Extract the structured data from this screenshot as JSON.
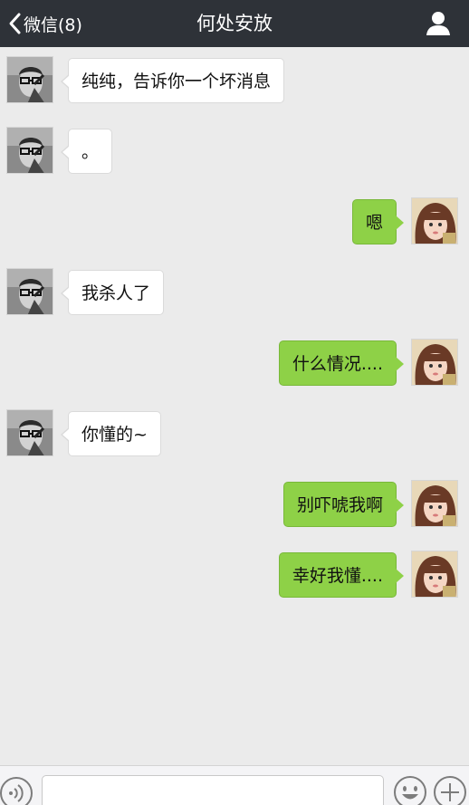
{
  "header": {
    "back_label": "微信(8)",
    "title": "何处安放",
    "bar_color": "#2e3238"
  },
  "messages": [
    {
      "side": "left",
      "text": "纯纯，告诉你一个坏消息"
    },
    {
      "side": "left",
      "text": "。"
    },
    {
      "side": "right",
      "text": "嗯"
    },
    {
      "side": "left",
      "text": "我杀人了"
    },
    {
      "side": "right",
      "text": "什么情况...."
    },
    {
      "side": "left",
      "text": "你懂的~"
    },
    {
      "side": "right",
      "text": "别吓唬我啊"
    },
    {
      "side": "right",
      "text": "幸好我懂...."
    }
  ],
  "colors": {
    "background": "#ebebeb",
    "sent_bubble": "#8ed147",
    "received_bubble": "#ffffff"
  },
  "input_bar": {
    "value": "",
    "icons": [
      "voice-icon",
      "emoji-icon",
      "plus-icon"
    ]
  }
}
